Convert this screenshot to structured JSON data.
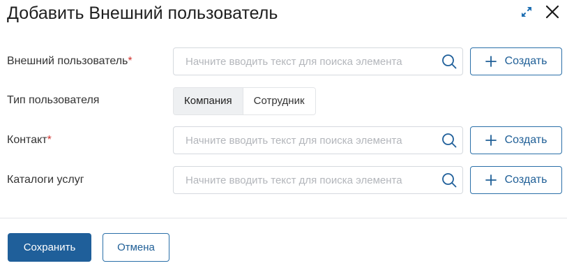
{
  "dialog": {
    "title": "Добавить Внешний пользователь",
    "icons": {
      "expand": "expand-icon",
      "close": "close-icon"
    }
  },
  "fields": {
    "external_user": {
      "label": "Внешний пользователь",
      "required_mark": "*",
      "placeholder": "Начните вводить текст для поиска элемента",
      "value": "",
      "create_label": "Создать"
    },
    "user_type": {
      "label": "Тип пользователя",
      "options": [
        "Компания",
        "Сотрудник"
      ],
      "selected": "Компания"
    },
    "contact": {
      "label": "Контакт",
      "required_mark": "*",
      "placeholder": "Начните вводить текст для поиска элемента",
      "value": "",
      "create_label": "Создать"
    },
    "service_catalogs": {
      "label": "Каталоги услуг",
      "placeholder": "Начните вводить текст для поиска элемента",
      "value": "",
      "create_label": "Создать"
    }
  },
  "footer": {
    "save_label": "Сохранить",
    "cancel_label": "Отмена"
  },
  "colors": {
    "primary": "#1f5f9a",
    "accent_border": "#2a6fa8",
    "required": "#d0332f",
    "segment_active_bg": "#eef0f2"
  }
}
